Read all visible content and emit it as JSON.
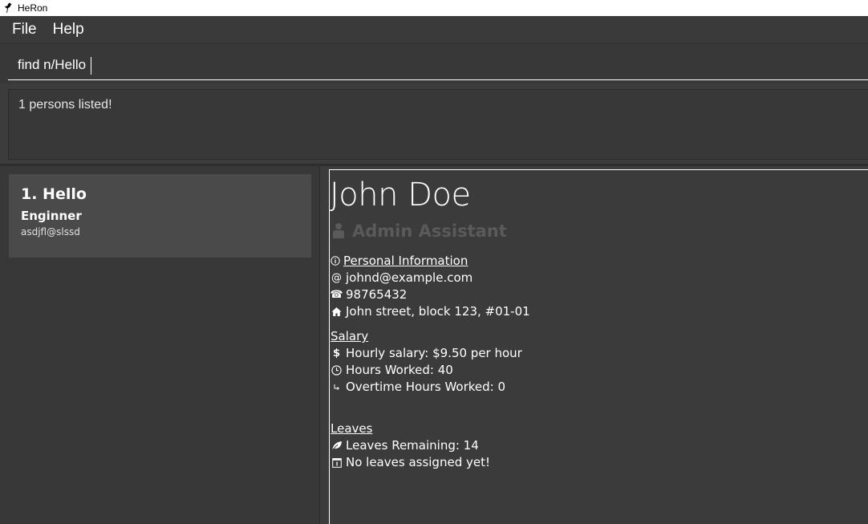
{
  "window": {
    "title": "HeRon",
    "app_icon": "heron-icon"
  },
  "menu": {
    "items": [
      {
        "label": "File"
      },
      {
        "label": "Help"
      }
    ]
  },
  "command_box": {
    "value": "find n/Hello"
  },
  "result_display": {
    "text": "1 persons listed!"
  },
  "person_list": [
    {
      "index_name": "1.  Hello",
      "role": "Enginner",
      "email": "asdjfl@slssd"
    }
  ],
  "details": {
    "name": "John Doe",
    "role": "Admin Assistant",
    "role_icon": "person-icon",
    "personal_info": {
      "heading": "Personal Information",
      "heading_icon": "info-icon",
      "email": "johnd@example.com",
      "email_icon": "at-icon",
      "phone": "98765432",
      "phone_icon": "phone-icon",
      "address": "John street, block 123, #01-01",
      "address_icon": "home-icon"
    },
    "salary": {
      "heading": "Salary",
      "hourly": "Hourly salary: $9.50 per hour",
      "hourly_icon": "dollar-icon",
      "hours_worked": "Hours Worked: 40",
      "hours_icon": "clock-icon",
      "overtime": "Overtime Hours Worked: 0",
      "overtime_icon": "overtime-arrow-icon"
    },
    "leaves": {
      "heading": "Leaves",
      "remaining": "Leaves Remaining: 14",
      "remaining_icon": "leaf-icon",
      "assigned": "No leaves assigned yet!",
      "assigned_icon": "calendar-icon"
    }
  },
  "colors": {
    "background": "#3c3c3c",
    "panel": "#383838",
    "card": "#4a4a4a",
    "muted_role": "#5a5a5a"
  }
}
